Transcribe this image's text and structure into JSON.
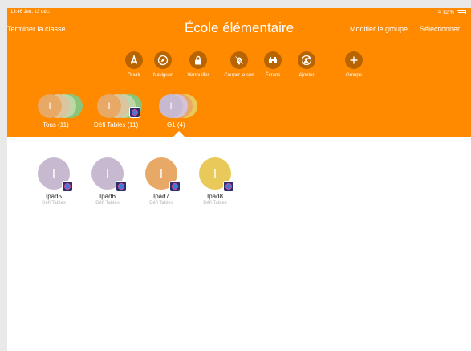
{
  "status": {
    "time_date": "13:46  Jeu. 13 déc.",
    "battery": "82 %"
  },
  "nav": {
    "left": "Terminer la classe",
    "title": "École élémentaire",
    "edit": "Modifier le groupe",
    "select": "Sélectionner"
  },
  "toolbar": [
    {
      "label": "Ouvrir",
      "icon": "app-store-icon"
    },
    {
      "label": "Naviguer",
      "icon": "compass-icon"
    },
    {
      "label": "Verrouiller",
      "icon": "lock-icon"
    },
    {
      "label": "Couper le son",
      "icon": "mute-bell-icon"
    },
    {
      "label": "Écrans",
      "icon": "binoculars-icon"
    },
    {
      "label": "Ajouter",
      "icon": "add-person-icon"
    },
    {
      "label": "Groupe",
      "icon": "plus-icon"
    }
  ],
  "groups": [
    {
      "label": "Tous (11)",
      "initial": "I"
    },
    {
      "label": "Défi Tables (11)",
      "initial": "I"
    },
    {
      "label": "G1 (4)",
      "initial": "I",
      "selected": true
    }
  ],
  "devices": [
    {
      "name": "Ipad5",
      "app": "Défi Tables",
      "initial": "I",
      "color": "#c7b9d0"
    },
    {
      "name": "Ipad6",
      "app": "Défi Tables",
      "initial": "I",
      "color": "#c7b9d0"
    },
    {
      "name": "Ipad7",
      "app": "Défi Tables",
      "initial": "I",
      "color": "#e8a866"
    },
    {
      "name": "Ipad8",
      "app": "Défi Tables",
      "initial": "I",
      "color": "#e8c95a"
    }
  ],
  "colors": {
    "accent": "#ff8a00",
    "button": "#b86400"
  }
}
